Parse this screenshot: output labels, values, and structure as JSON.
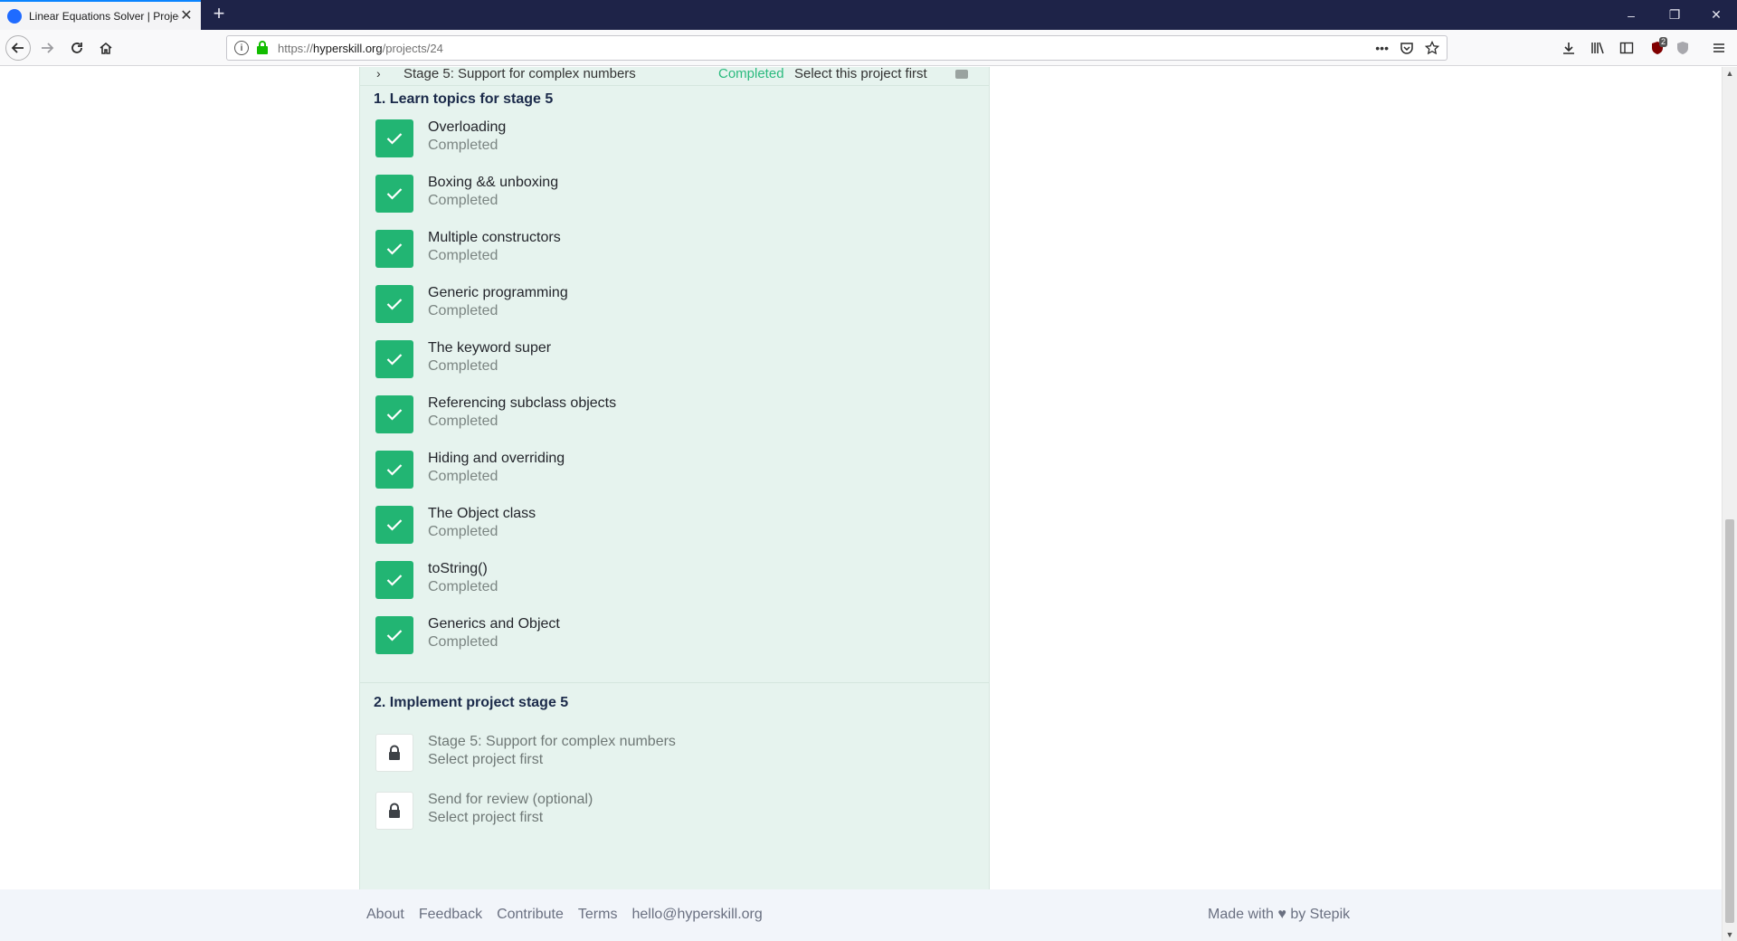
{
  "browser": {
    "tab_title": "Linear Equations Solver | Projects",
    "tab_close": "✕",
    "new_tab": "+",
    "url_scheme": "https://",
    "url_host": "hyperskill.org",
    "url_path": "/projects/24",
    "url_more": "•••",
    "extension_badge": "2",
    "window_controls": [
      "–",
      "❐",
      "✕"
    ]
  },
  "stage_row": {
    "chevron": "›",
    "name": "Stage 5: Support for complex numbers",
    "status": "Completed",
    "action": "Select this project first"
  },
  "learn": {
    "title": "1. Learn topics for stage 5",
    "topics": [
      {
        "title": "Overloading",
        "status": "Completed"
      },
      {
        "title": "Boxing && unboxing",
        "status": "Completed"
      },
      {
        "title": "Multiple constructors",
        "status": "Completed"
      },
      {
        "title": "Generic programming",
        "status": "Completed"
      },
      {
        "title": "The keyword super",
        "status": "Completed"
      },
      {
        "title": "Referencing subclass objects",
        "status": "Completed"
      },
      {
        "title": "Hiding and overriding",
        "status": "Completed"
      },
      {
        "title": "The Object class",
        "status": "Completed"
      },
      {
        "title": "toString()",
        "status": "Completed"
      },
      {
        "title": "Generics and Object",
        "status": "Completed"
      }
    ]
  },
  "implement": {
    "title": "2. Implement project stage 5",
    "steps": [
      {
        "title": "Stage 5: Support for complex numbers",
        "status": "Select project first"
      },
      {
        "title": "Send for review (optional)",
        "status": "Select project first"
      }
    ]
  },
  "footer": {
    "links": [
      "About",
      "Feedback",
      "Contribute",
      "Terms",
      "hello@hyperskill.org"
    ],
    "made_with": "Made with ♥ by Stepik"
  },
  "colors": {
    "check_green": "#22b573",
    "panel_bg": "#e6f3ee",
    "titlebar": "#1e2348",
    "heading": "#1b2a4a"
  },
  "icons": [
    "back-icon",
    "forward-icon",
    "reload-icon",
    "home-icon",
    "info-icon",
    "lock-icon",
    "pocket-icon",
    "star-icon",
    "download-icon",
    "library-icon",
    "sidebar-icon",
    "ublock-icon",
    "tracking-shield-icon",
    "menu-icon",
    "check-icon",
    "padlock-icon"
  ]
}
